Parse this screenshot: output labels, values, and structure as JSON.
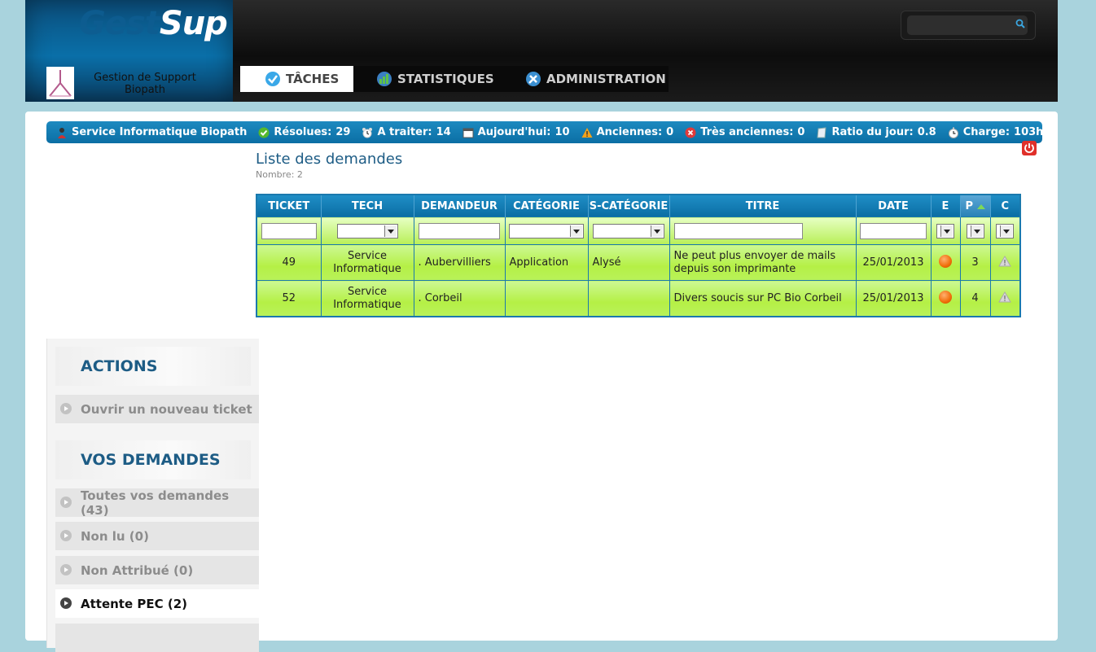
{
  "app": {
    "name_part1": "Gest",
    "name_part2": "Sup",
    "company_line1": "Gestion de Support",
    "company_line2": "Biopath"
  },
  "header_search": {
    "placeholder": ""
  },
  "menu": [
    {
      "label": "TÂCHES",
      "icon": "check-icon",
      "active": true
    },
    {
      "label": "STATISTIQUES",
      "icon": "chart-globe-icon",
      "active": false
    },
    {
      "label": "ADMINISTRATION",
      "icon": "tools-icon",
      "active": false
    }
  ],
  "statusbar": {
    "service": "Service Informatique Biopath",
    "resolved_label": "Résolues:",
    "resolved_value": "29",
    "todo_label": "A traiter:",
    "todo_value": "14",
    "today_label": "Aujourd'hui:",
    "today_value": "10",
    "old_label": "Anciennes:",
    "old_value": "0",
    "very_old_label": "Très anciennes:",
    "very_old_value": "0",
    "ratio_label": "Ratio du jour:",
    "ratio_value": "0.8",
    "load_label": "Charge:",
    "load_value": "103h"
  },
  "list": {
    "title": "Liste des demandes",
    "count": "Nombre: 2"
  },
  "table": {
    "headers": [
      "TICKET",
      "TECH",
      "DEMANDEUR",
      "CATÉGORIE",
      "S-CATÉGORIE",
      "TITRE",
      "DATE",
      "E",
      "P",
      "C"
    ],
    "rows": [
      {
        "ticket": "49",
        "tech_line1": "Service",
        "tech_line2": "Informatique",
        "requester": ". Aubervilliers",
        "category": "Application",
        "subcategory": "Alysé",
        "title_line1": "Ne peut plus envoyer de mails",
        "title_line2": "depuis son imprimante",
        "date": "25/01/2013",
        "state": "orange",
        "priority": "3",
        "criticality": "warning-icon"
      },
      {
        "ticket": "52",
        "tech_line1": "Service",
        "tech_line2": "Informatique",
        "requester": ". Corbeil",
        "category": "",
        "subcategory": "",
        "title_line1": "Divers soucis sur PC Bio Corbeil",
        "title_line2": "",
        "date": "25/01/2013",
        "state": "orange",
        "priority": "4",
        "criticality": "warning-icon"
      }
    ]
  },
  "sidebar": {
    "actions_heading": "ACTIONS",
    "new_ticket": "Ouvrir un nouveau ticket",
    "requests_heading": "VOS DEMANDES",
    "items": [
      {
        "label": "Toutes vos demandes (43)"
      },
      {
        "label": "Non lu (0)"
      },
      {
        "label": "Non Attribué (0)"
      },
      {
        "label": "Attente PEC (2)"
      }
    ]
  },
  "colors": {
    "header_blue": "#0a6fa8",
    "row_green": "#b5f046",
    "title_blue": "#1d5c85"
  }
}
